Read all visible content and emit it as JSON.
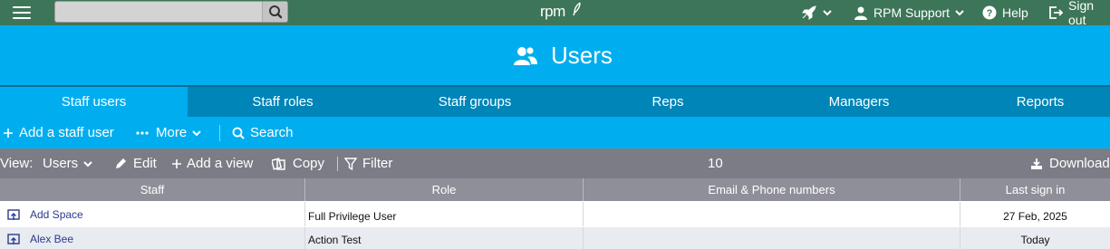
{
  "topbar": {
    "search": {
      "placeholder": "",
      "value": ""
    },
    "logo_text": "rpm",
    "support_label": "RPM Support",
    "help_label": "Help",
    "signout_label": "Sign out"
  },
  "header": {
    "title": "Users"
  },
  "tabs": [
    {
      "label": "Staff users",
      "active": true
    },
    {
      "label": "Staff roles",
      "active": false
    },
    {
      "label": "Staff groups",
      "active": false
    },
    {
      "label": "Reps",
      "active": false
    },
    {
      "label": "Managers",
      "active": false
    },
    {
      "label": "Reports",
      "active": false
    }
  ],
  "actions": {
    "add_label": "Add a staff user",
    "more_label": "More",
    "search_label": "Search"
  },
  "viewbar": {
    "view_label": "View:",
    "view_value": "Users",
    "edit_label": "Edit",
    "add_view_label": "Add a view",
    "copy_label": "Copy",
    "filter_label": "Filter",
    "count": "10",
    "download_label": "Download"
  },
  "table": {
    "columns": [
      "Staff",
      "Role",
      "Email & Phone numbers",
      "Last sign in"
    ],
    "rows": [
      {
        "staff": "Add Space",
        "role": "Full Privilege User",
        "email": "",
        "last_sign_in": "27 Feb, 2025"
      },
      {
        "staff": "Alex Bee",
        "role": "Action Test",
        "email": "",
        "last_sign_in": "Today"
      }
    ]
  },
  "colors": {
    "topbar": "#3d7558",
    "accent": "#00aeef",
    "tab_bar": "#0085b8",
    "view_bar": "#7c7c86",
    "table_header": "#8f8f99",
    "link": "#2b3a8f"
  }
}
